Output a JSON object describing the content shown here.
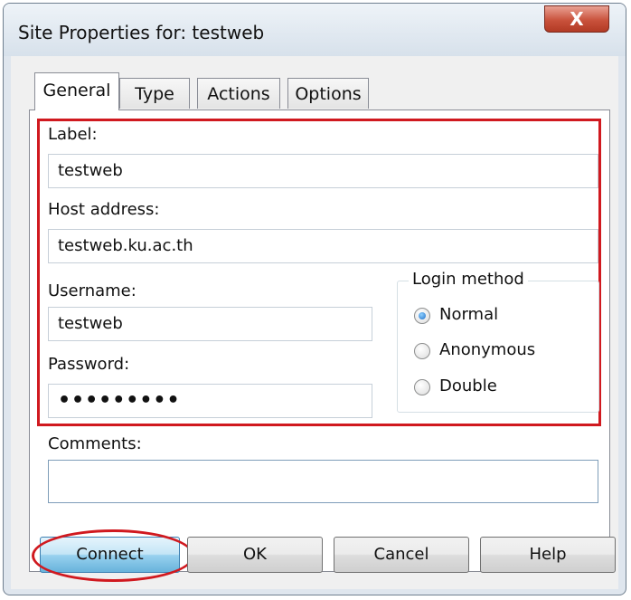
{
  "window": {
    "title": "Site Properties for: testweb",
    "close_label": "X"
  },
  "tabs": [
    {
      "label": "General",
      "active": true
    },
    {
      "label": "Type",
      "active": false
    },
    {
      "label": "Actions",
      "active": false
    },
    {
      "label": "Options",
      "active": false
    }
  ],
  "form": {
    "label": {
      "caption": "Label:",
      "value": "testweb"
    },
    "host": {
      "caption": "Host address:",
      "value": "testweb.ku.ac.th"
    },
    "username": {
      "caption": "Username:",
      "value": "testweb"
    },
    "password": {
      "caption": "Password:",
      "value": "•••••••••"
    },
    "comments": {
      "caption": "Comments:",
      "value": ""
    }
  },
  "login_method": {
    "title": "Login method",
    "options": [
      {
        "label": "Normal",
        "selected": true
      },
      {
        "label": "Anonymous",
        "selected": false
      },
      {
        "label": "Double",
        "selected": false
      }
    ]
  },
  "buttons": {
    "connect": "Connect",
    "ok": "OK",
    "cancel": "Cancel",
    "help": "Help"
  },
  "colors": {
    "highlight_red": "#d0191f",
    "close_button": "#c9523c",
    "default_button": "#98d1ef"
  }
}
